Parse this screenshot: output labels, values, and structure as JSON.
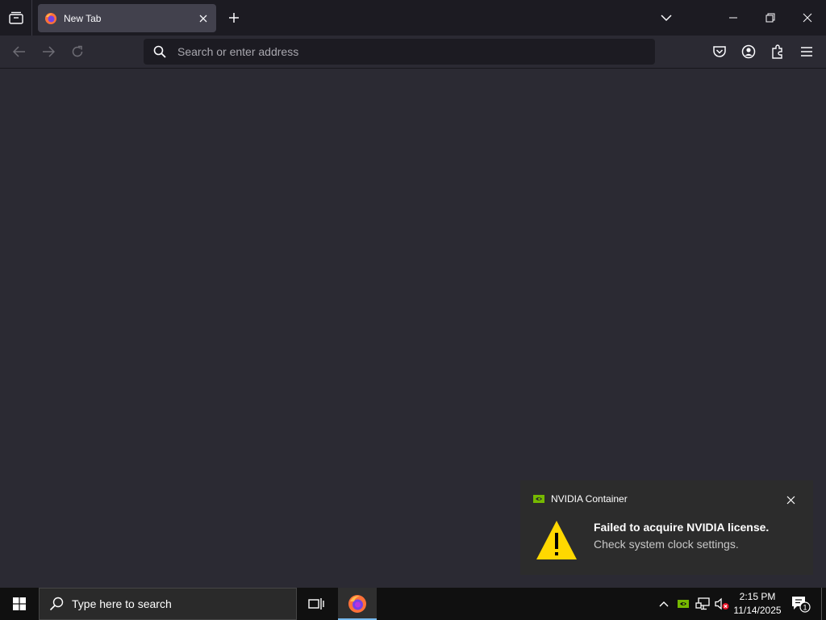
{
  "browser": {
    "tab": {
      "title": "New Tab"
    },
    "urlbar": {
      "placeholder": "Search or enter address"
    }
  },
  "notification": {
    "app_name": "NVIDIA Container",
    "title": "Failed to acquire NVIDIA license.",
    "body": "Check system clock settings."
  },
  "taskbar": {
    "search_placeholder": "Type here to search",
    "time": "2:15 PM",
    "date": "11/14/2025",
    "notification_count": "1"
  },
  "colors": {
    "accent_firefox": "#ff7139",
    "nvidia_green": "#76b900",
    "warning_yellow": "#ffd800"
  }
}
